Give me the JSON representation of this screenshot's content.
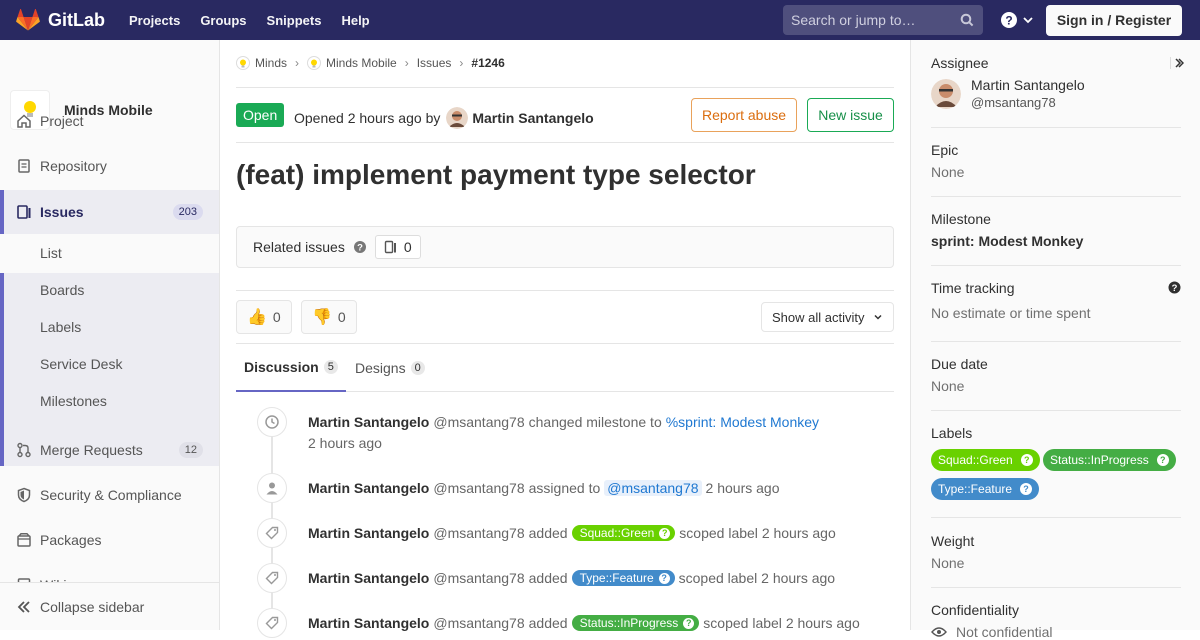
{
  "topnav": {
    "brand": "GitLab",
    "links": [
      "Projects",
      "Groups",
      "Snippets",
      "Help"
    ],
    "search_placeholder": "Search or jump to…",
    "signin": "Sign in / Register"
  },
  "sidebar": {
    "project_name": "Minds Mobile",
    "items": [
      {
        "label": "Project",
        "icon": "home-icon"
      },
      {
        "label": "Repository",
        "icon": "doc-icon"
      },
      {
        "label": "Issues",
        "count": "203",
        "icon": "issues-icon"
      },
      {
        "label": "Merge Requests",
        "count": "12",
        "icon": "merge-icon"
      },
      {
        "label": "Security & Compliance",
        "icon": "shield-icon"
      },
      {
        "label": "Packages",
        "icon": "package-icon"
      },
      {
        "label": "Wiki",
        "icon": "book-icon"
      }
    ],
    "issues_sub": [
      "List",
      "Boards",
      "Labels",
      "Service Desk",
      "Milestones"
    ],
    "collapse": "Collapse sidebar"
  },
  "breadcrumb": [
    "Minds",
    "Minds Mobile",
    "Issues",
    "#1246"
  ],
  "issue": {
    "status": "Open",
    "opened_text": "Opened",
    "opened_time": "2 hours ago",
    "by": "by",
    "author": "Martin Santangelo",
    "report_abuse": "Report abuse",
    "new_issue": "New issue",
    "title": "(feat) implement payment type selector",
    "related_title": "Related issues",
    "related_count": "0",
    "thumbs_up": "0",
    "thumbs_down": "0",
    "activity_filter": "Show all activity",
    "tabs": [
      {
        "label": "Discussion",
        "count": "5"
      },
      {
        "label": "Designs",
        "count": "0"
      }
    ]
  },
  "notes": [
    {
      "author": "Martin Santangelo",
      "handle": "@msantang78",
      "text": "changed milestone to",
      "ref": "%sprint: Modest Monkey",
      "time": "2 hours ago"
    },
    {
      "author": "Martin Santangelo",
      "handle": "@msantang78",
      "text": "assigned to",
      "ref": "@msantang78",
      "time": "2 hours ago"
    },
    {
      "author": "Martin Santangelo",
      "handle": "@msantang78",
      "text": "added",
      "label": "Squad::Green",
      "label_color": "#69d100",
      "suffix": "scoped label",
      "time": "2 hours ago"
    },
    {
      "author": "Martin Santangelo",
      "handle": "@msantang78",
      "text": "added",
      "label": "Type::Feature",
      "label_color": "#428bca",
      "suffix": "scoped label",
      "time": "2 hours ago"
    },
    {
      "author": "Martin Santangelo",
      "handle": "@msantang78",
      "text": "added",
      "label": "Status::InProgress",
      "label_color": "#44ad44",
      "suffix": "scoped label",
      "time": "2 hours ago"
    }
  ],
  "right": {
    "assignee_label": "Assignee",
    "assignee_name": "Martin Santangelo",
    "assignee_handle": "@msantang78",
    "epic_label": "Epic",
    "epic_value": "None",
    "milestone_label": "Milestone",
    "milestone_value": "sprint: Modest Monkey",
    "time_label": "Time tracking",
    "time_value": "No estimate or time spent",
    "due_label": "Due date",
    "due_value": "None",
    "labels_label": "Labels",
    "labels": [
      {
        "name": "Squad::Green",
        "color": "#69d100"
      },
      {
        "name": "Status::InProgress",
        "color": "#44ad44"
      },
      {
        "name": "Type::Feature",
        "color": "#428bca"
      }
    ],
    "weight_label": "Weight",
    "weight_value": "None",
    "confidentiality_label": "Confidentiality",
    "confidentiality_value": "Not confidential"
  }
}
